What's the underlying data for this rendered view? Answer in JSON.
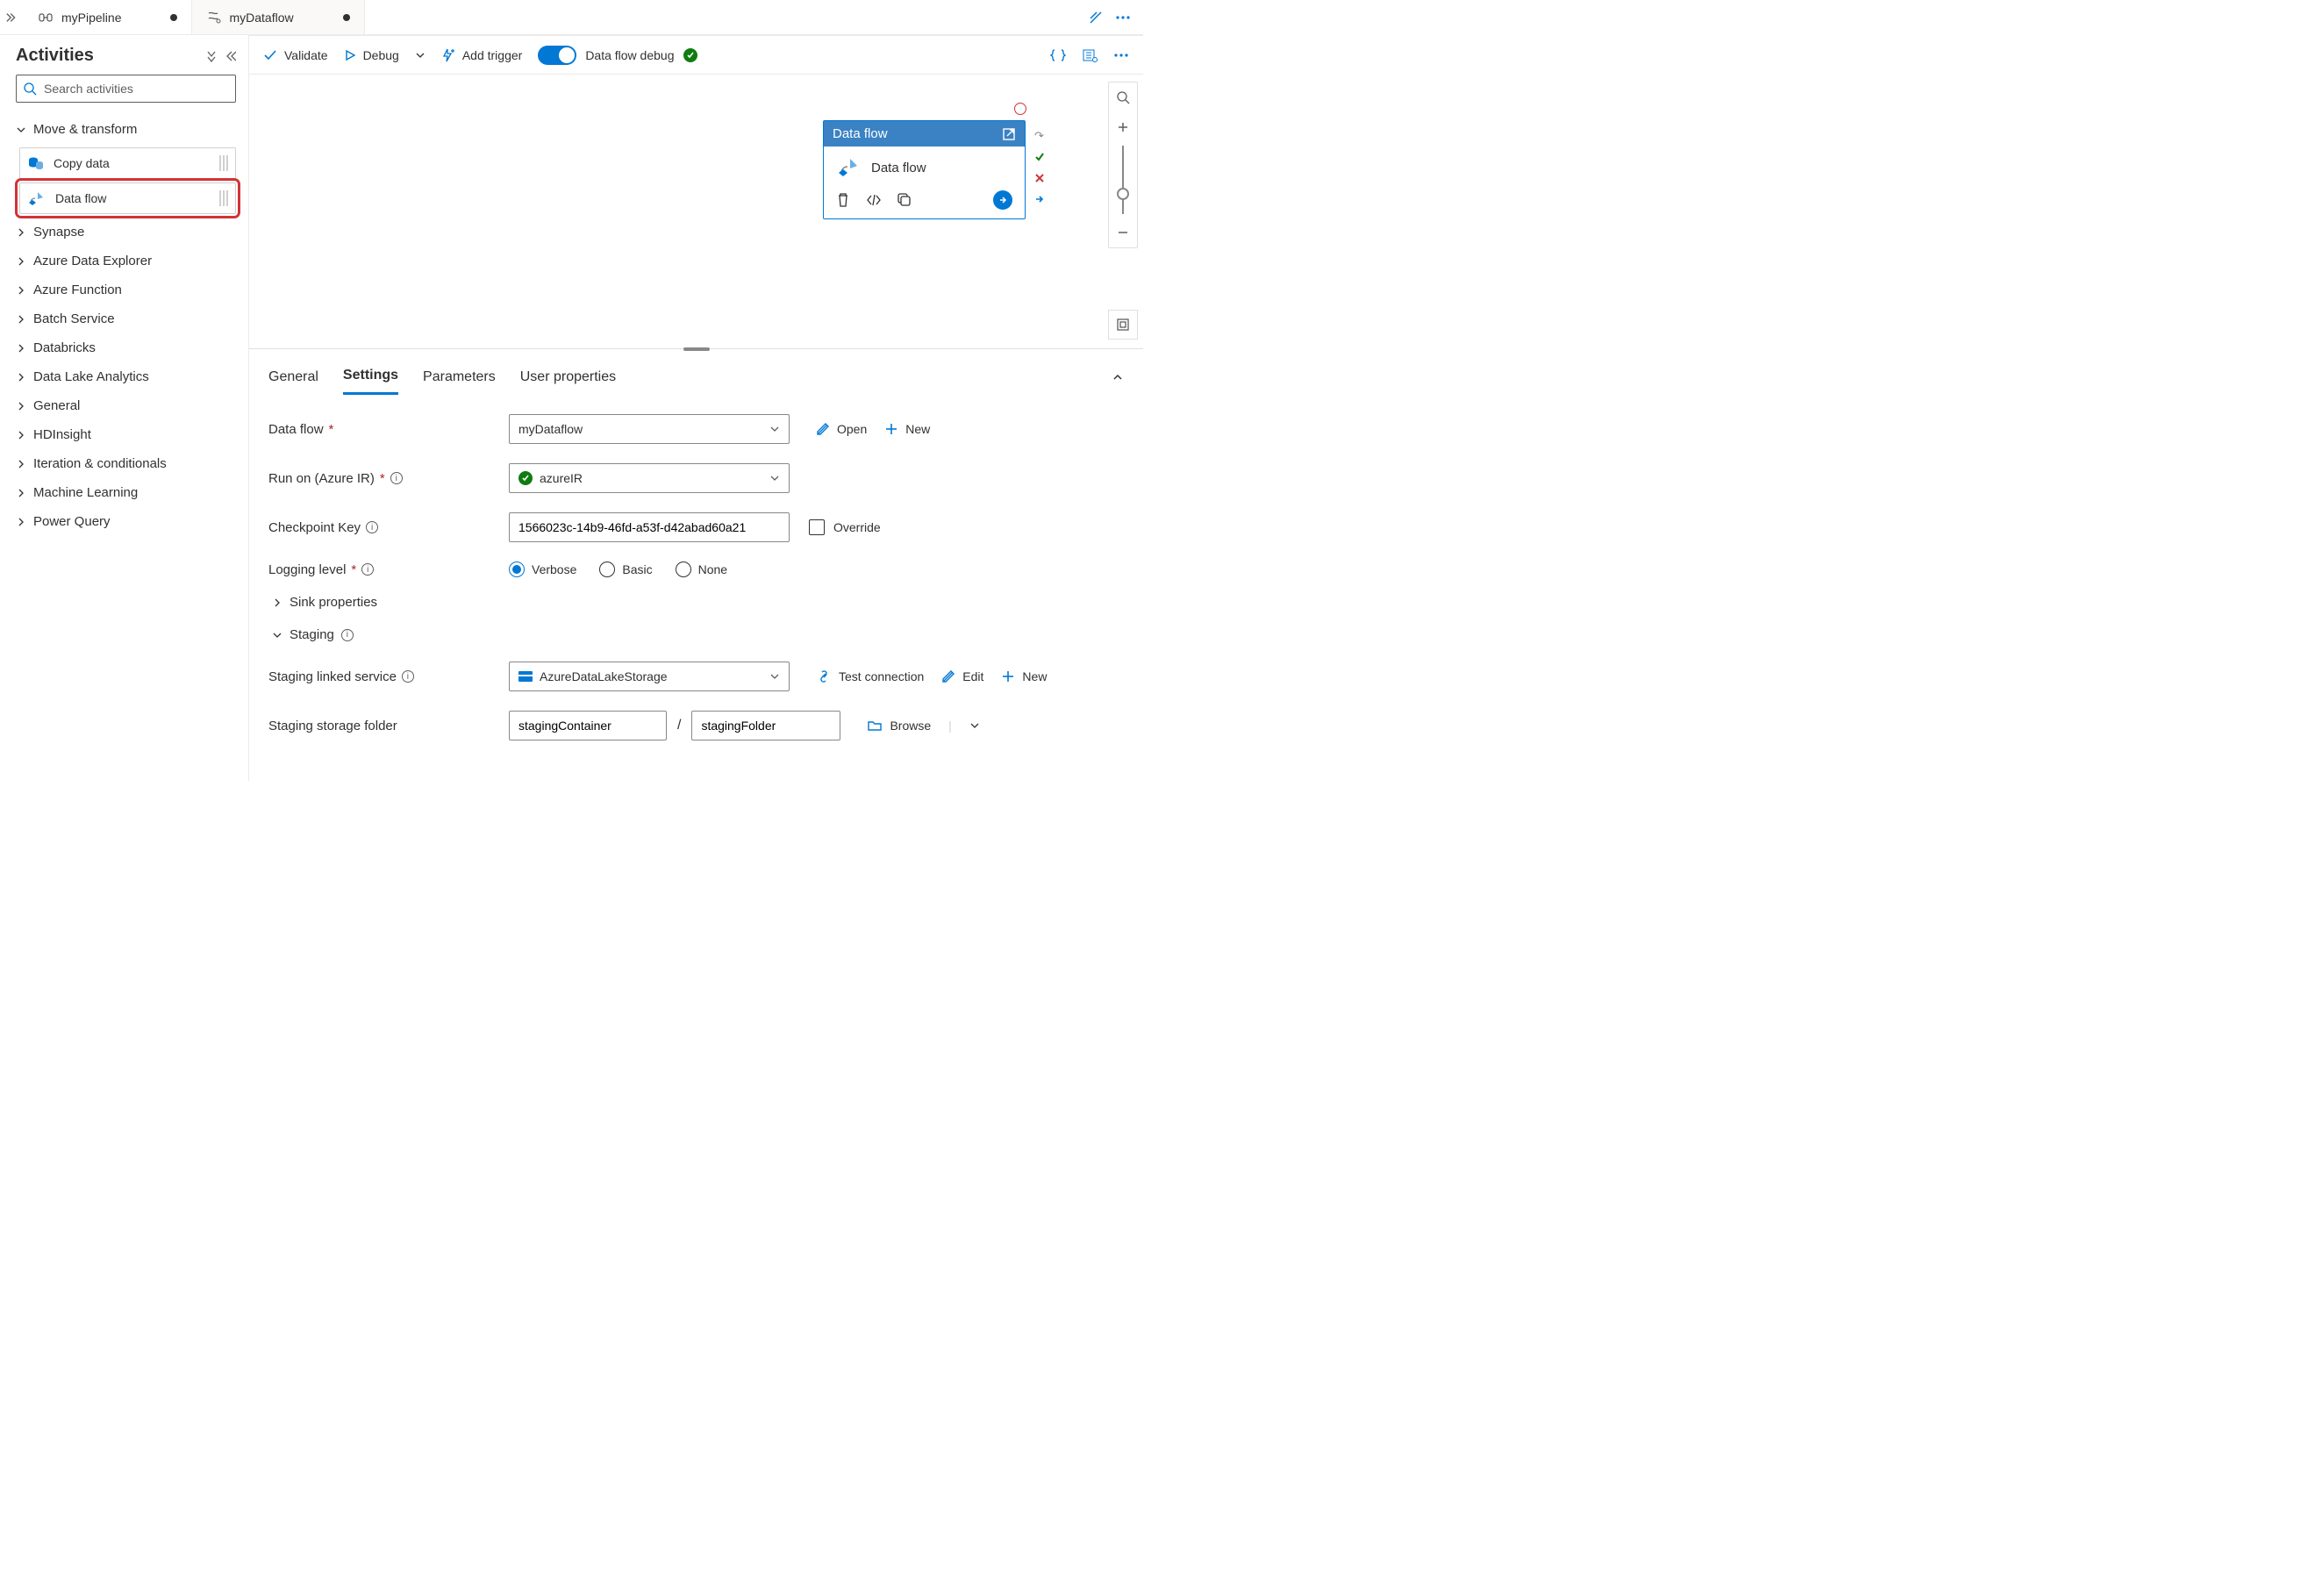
{
  "tabs": [
    {
      "label": "myPipeline",
      "dirty": true,
      "active": true
    },
    {
      "label": "myDataflow",
      "dirty": true,
      "active": false
    }
  ],
  "activities": {
    "title": "Activities",
    "search_placeholder": "Search activities",
    "expanded_category": "Move & transform",
    "items_in_expanded": [
      "Copy data",
      "Data flow"
    ],
    "categories": [
      "Synapse",
      "Azure Data Explorer",
      "Azure Function",
      "Batch Service",
      "Databricks",
      "Data Lake Analytics",
      "General",
      "HDInsight",
      "Iteration & conditionals",
      "Machine Learning",
      "Power Query"
    ]
  },
  "toolbar": {
    "validate": "Validate",
    "debug": "Debug",
    "add_trigger": "Add trigger",
    "df_debug": "Data flow debug"
  },
  "canvas_node": {
    "header": "Data flow",
    "body_label": "Data flow"
  },
  "props_tabs": [
    "General",
    "Settings",
    "Parameters",
    "User properties"
  ],
  "props_active_tab": "Settings",
  "settings": {
    "labels": {
      "data_flow": "Data flow",
      "run_on": "Run on (Azure IR)",
      "checkpoint": "Checkpoint Key",
      "logging": "Logging level",
      "sink": "Sink properties",
      "staging": "Staging",
      "staging_linked": "Staging linked service",
      "staging_folder": "Staging storage folder"
    },
    "data_flow_value": "myDataflow",
    "run_on_value": "azureIR",
    "checkpoint_value": "1566023c-14b9-46fd-a53f-d42abad60a21",
    "checkpoint_override": "Override",
    "logging_options": [
      "Verbose",
      "Basic",
      "None"
    ],
    "logging_selected": "Verbose",
    "staging_linked_value": "AzureDataLakeStorage",
    "staging_container": "stagingContainer",
    "staging_folder": "stagingFolder",
    "actions": {
      "open": "Open",
      "new": "New",
      "test_conn": "Test connection",
      "edit": "Edit",
      "browse": "Browse"
    }
  }
}
